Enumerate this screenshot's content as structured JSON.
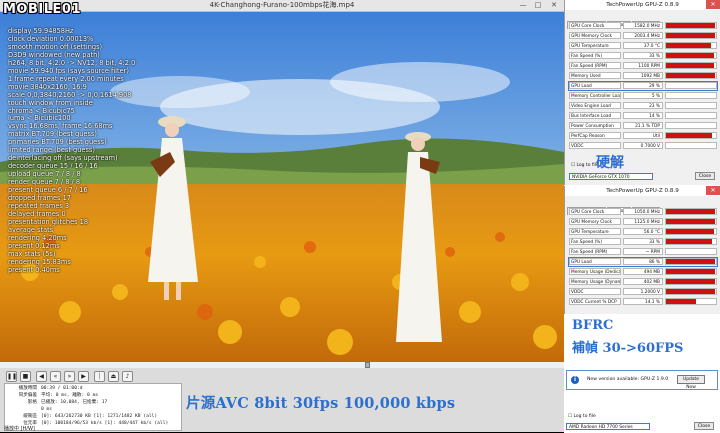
{
  "logo": {
    "text": "MOBILE01"
  },
  "player": {
    "title": "4K-Changhong-Furano-100mbps花海.mp4",
    "osd_lines": [
      "display 59.94858Hz",
      "clock deviation 0.00013%",
      "smooth motion off (settings)",
      "D3D9 windowed (new path)",
      "h264, 8 bit, 4:2:0 -> NV12, 8 bit, 4:2:0",
      "movie 59.940 fps  (says source filter)",
      "1 frame repeat every 2.00 minutes",
      "movie 3840x2160, 16:9",
      "scale 0,0,3840,2160 -> 0,0,1614,908",
      "touch window from inside",
      "chroma < Bicubic75",
      "luma < Bicubic100",
      "vsync 16.68ms, frame 16.68ms",
      "matrix BT.709 (best guess)",
      "primaries BT.709 (best guess)",
      "limited range (best guess)",
      "deinterlacing off (says upstream)",
      "decoder queue 15 / 16 / 16",
      "upload queue 7 / 8 / 8",
      "render queue 7 / 8 / 8",
      "present queue 6 / 7 / 16",
      "dropped frames 17",
      "repeated frames 3",
      "delayed frames 0",
      "presentation glitches 18",
      "average stats",
      "    rendering 4.20ms",
      "    present 0.12ms",
      "max stats (5s)",
      "    rendering 15.83ms",
      "    present 0.40ms"
    ],
    "stats": [
      {
        "label": "播放時間",
        "value": "00:39 / 01:00:d"
      },
      {
        "label": "同步偏差",
        "value": "平均: 0 ms, 離散: 0 ms"
      },
      {
        "label": "影格",
        "value": "已播放: 10,084, 已捨棄: 17"
      },
      {
        "label": "",
        "value": "0 ms"
      },
      {
        "label": "緩衝區",
        "value": "[0]: 643/262730 KB [1]: 1271/1482 KB (all)"
      },
      {
        "label": "位元率",
        "value": "[0]: 100184/96/53 kb/s [1]: 448/447 kb/s (all)"
      }
    ],
    "status_text": "播放中 [H/W]",
    "seek_progress": 0.648,
    "caption": "片源AVC 8bit 30fps 100,000 kbps"
  },
  "gpuz_top": {
    "title": "TechPowerUp GPU-Z 0.8.9",
    "tabs": [
      "Graphics Card",
      "Sensors",
      "Validation"
    ],
    "rows": [
      {
        "label": "GPU Core Clock",
        "value": "1582.0 MHz",
        "fill": 0.98
      },
      {
        "label": "GPU Memory Clock",
        "value": "2003.4 MHz",
        "fill": 0.98
      },
      {
        "label": "GPU Temperature",
        "value": "37.0 °C",
        "fill": 0.9
      },
      {
        "label": "Fan Speed (%)",
        "value": "33 %",
        "fill": 0.95
      },
      {
        "label": "Fan Speed (RPM)",
        "value": "1100 RPM",
        "fill": 0.95
      },
      {
        "label": "Memory Used",
        "value": "1092 MB",
        "fill": 0.98
      },
      {
        "label": "GPU Load",
        "value": "29 %",
        "fill": 0.0
      },
      {
        "label": "Memory Controller Load",
        "value": "5 %",
        "fill": 0.0
      },
      {
        "label": "Video Engine Load",
        "value": "23 %",
        "fill": 0.0
      },
      {
        "label": "Bus Interface Load",
        "value": "14 %",
        "fill": 0.0
      },
      {
        "label": "Power Consumption",
        "value": "21.1 % TDP",
        "fill": 0.0
      },
      {
        "label": "PerfCap Reason",
        "value": "Util",
        "fill": 0.92
      },
      {
        "label": "VDDC",
        "value": "0.7000 V",
        "fill": 0.0
      }
    ],
    "log_label": "Log to file",
    "device": "NVIDIA GeForce GTX 1070",
    "close": "Close"
  },
  "gpuz_bottom": {
    "title": "TechPowerUp GPU-Z 0.8.9",
    "tabs": [
      "Graphics Card",
      "Sensors",
      "Validation"
    ],
    "rows": [
      {
        "label": "GPU Core Clock",
        "value": "1050.0 MHz",
        "fill": 0.98
      },
      {
        "label": "GPU Memory Clock",
        "value": "1125.0 MHz",
        "fill": 0.98
      },
      {
        "label": "GPU Temperature",
        "value": "56.0 °C",
        "fill": 0.95
      },
      {
        "label": "Fan Speed (%)",
        "value": "33 %",
        "fill": 0.92
      },
      {
        "label": "Fan Speed (RPM)",
        "value": "~ RPM",
        "fill": 0.0
      },
      {
        "label": "GPU Load",
        "value": "86 %",
        "fill": 0.98
      },
      {
        "label": "Memory Usage (Dedicated)",
        "value": "494 MB",
        "fill": 0.98
      },
      {
        "label": "Memory Usage (Dynamic)",
        "value": "402 MB",
        "fill": 0.98
      },
      {
        "label": "VDDC",
        "value": "1.2000 V",
        "fill": 0.98
      },
      {
        "label": "VDDC Current % DCP",
        "value": "14.1 %",
        "fill": 0.6
      }
    ],
    "log_label": "Log to file",
    "device": "AMD Radeon HD 7700 Series",
    "close": "Close"
  },
  "update": {
    "text": "New version available: GPU-Z 1.9.0",
    "button": "Update Now"
  },
  "captions": {
    "hard": "硬解",
    "bfrc": "BFRC",
    "interp": "補幀 30->60FPS"
  },
  "colors": {
    "caption": "#2b6fd1",
    "graph": "#d01010",
    "highlight": "#3a7bd5"
  }
}
